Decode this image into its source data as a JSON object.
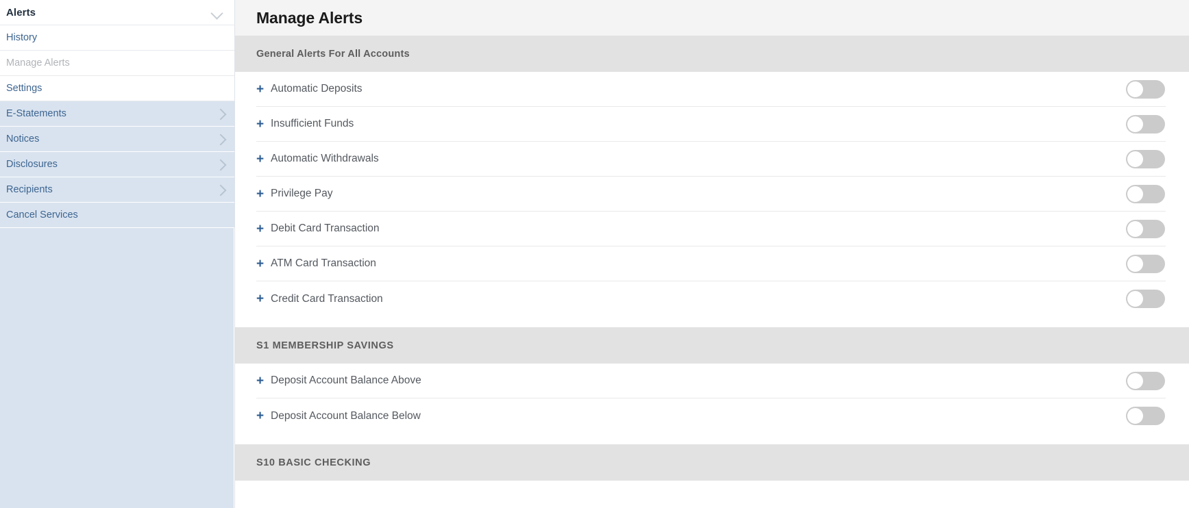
{
  "sidebar": {
    "header": {
      "title": "Alerts",
      "icon": "chevron-down-icon"
    },
    "items": [
      {
        "label": "History",
        "style": "white",
        "active": false,
        "chevron": false
      },
      {
        "label": "Manage Alerts",
        "style": "white",
        "active": true,
        "chevron": false
      },
      {
        "label": "Settings",
        "style": "white",
        "active": false,
        "chevron": false
      },
      {
        "label": "E-Statements",
        "style": "blue",
        "active": false,
        "chevron": true
      },
      {
        "label": "Notices",
        "style": "blue",
        "active": false,
        "chevron": true
      },
      {
        "label": "Disclosures",
        "style": "blue",
        "active": false,
        "chevron": true
      },
      {
        "label": "Recipients",
        "style": "blue",
        "active": false,
        "chevron": true
      },
      {
        "label": "Cancel Services",
        "style": "blue",
        "active": false,
        "chevron": false
      }
    ]
  },
  "page": {
    "title": "Manage Alerts"
  },
  "sections": [
    {
      "title": "General Alerts For All Accounts",
      "uppercase": false,
      "rows": [
        {
          "label": "Automatic Deposits",
          "icon": "plus-icon",
          "toggle": "off"
        },
        {
          "label": "Insufficient Funds",
          "icon": "plus-icon",
          "toggle": "off"
        },
        {
          "label": "Automatic Withdrawals",
          "icon": "plus-icon",
          "toggle": "off"
        },
        {
          "label": "Privilege Pay",
          "icon": "plus-icon",
          "toggle": "off"
        },
        {
          "label": "Debit Card Transaction",
          "icon": "plus-icon",
          "toggle": "off"
        },
        {
          "label": "ATM Card Transaction",
          "icon": "plus-icon",
          "toggle": "off"
        },
        {
          "label": "Credit Card Transaction",
          "icon": "plus-icon",
          "toggle": "off"
        }
      ]
    },
    {
      "title": "S1 MEMBERSHIP SAVINGS",
      "uppercase": true,
      "rows": [
        {
          "label": "Deposit Account Balance Above",
          "icon": "plus-icon",
          "toggle": "off"
        },
        {
          "label": "Deposit Account Balance Below",
          "icon": "plus-icon",
          "toggle": "off"
        }
      ]
    },
    {
      "title": "S10 BASIC CHECKING",
      "uppercase": true,
      "rows": []
    }
  ],
  "colors": {
    "sidebar_link": "#3d6591",
    "sidebar_active": "#b0b4b9",
    "sidebar_highlight": "#d9e3ef",
    "section_header_bg": "#e2e2e2",
    "page_header_bg": "#f4f4f4",
    "plus_icon": "#2d5d92",
    "toggle_off": "#cbcbcb"
  }
}
